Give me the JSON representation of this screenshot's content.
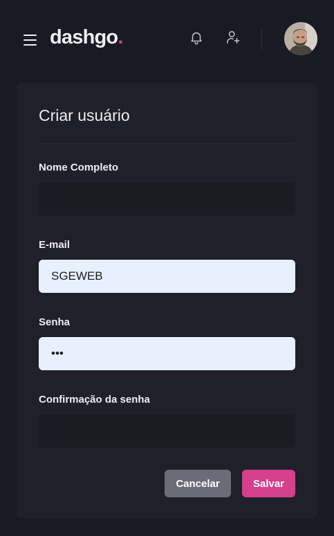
{
  "header": {
    "logo_text": "dashgo",
    "logo_dot": ".",
    "accent_color": "#d53f8c",
    "icons": [
      "menu-icon",
      "bell-icon",
      "user-add-icon"
    ]
  },
  "form": {
    "title": "Criar usuário",
    "fields": [
      {
        "label": "Nome Completo",
        "value": ""
      },
      {
        "label": "E-mail",
        "value": "SGEWEB"
      },
      {
        "label": "Senha",
        "value": "•••"
      },
      {
        "label": "Confirmação da senha",
        "value": ""
      }
    ],
    "cancel_label": "Cancelar",
    "save_label": "Salvar"
  }
}
